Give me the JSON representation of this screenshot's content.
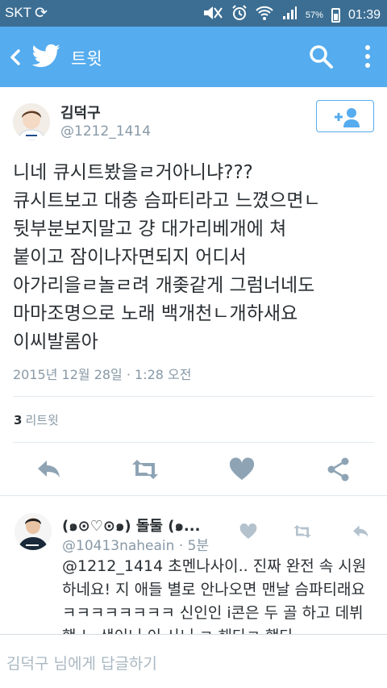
{
  "status_bar": {
    "carrier": "SKT",
    "battery": "57%",
    "time": "01:39"
  },
  "app_bar": {
    "title": "트윗"
  },
  "tweet": {
    "author_name": "김덕구",
    "author_handle": "@1212_1414",
    "text_lines": [
      "니네 큐시트봤을ㄹ거아니냐???",
      "큐시트보고 대충 슴파티라고 느꼈으면ㄴ",
      "뒷부분보지말고 걍 대가리베개에 쳐",
      "붙이고 잠이나자면되지 어디서",
      "아가리을ㄹ놀ㄹ려 개좆같게 그럼너네도",
      "마마조명으로 노래 백개천ㄴ개하새요",
      "이씨발롬아"
    ],
    "timestamp": "2015년 12월 28일 · 1:28 오전",
    "retweet_count": "3",
    "retweet_label": "리트윗"
  },
  "reply": {
    "author_name": "(๑⊙♡⊙๑) 돌둘 (๑...",
    "author_handle": "@10413naheain",
    "age": "5분",
    "text": "@1212_1414 초멘나사이.. 진짜 완전 속 시원하네요! 지 애들 별로 안나오면 맨날 슴파티래요 ㅋㅋㅋㅋㅋㅋㅋㅋ 신인인 i콘은 두 골 하고 데뷔했 노 생이니 이 사니 ㄹ 해다ㄹ 했다..."
  },
  "reply_bar": {
    "placeholder": "김덕구 님에게 답글하기"
  },
  "colors": {
    "status_bar": "#3c6e93",
    "app_bar": "#55acee",
    "action_icon": "#8ea4b5",
    "reply_action_icon": "#b4c2cd",
    "text": "#292f33",
    "muted": "#8899a6"
  }
}
